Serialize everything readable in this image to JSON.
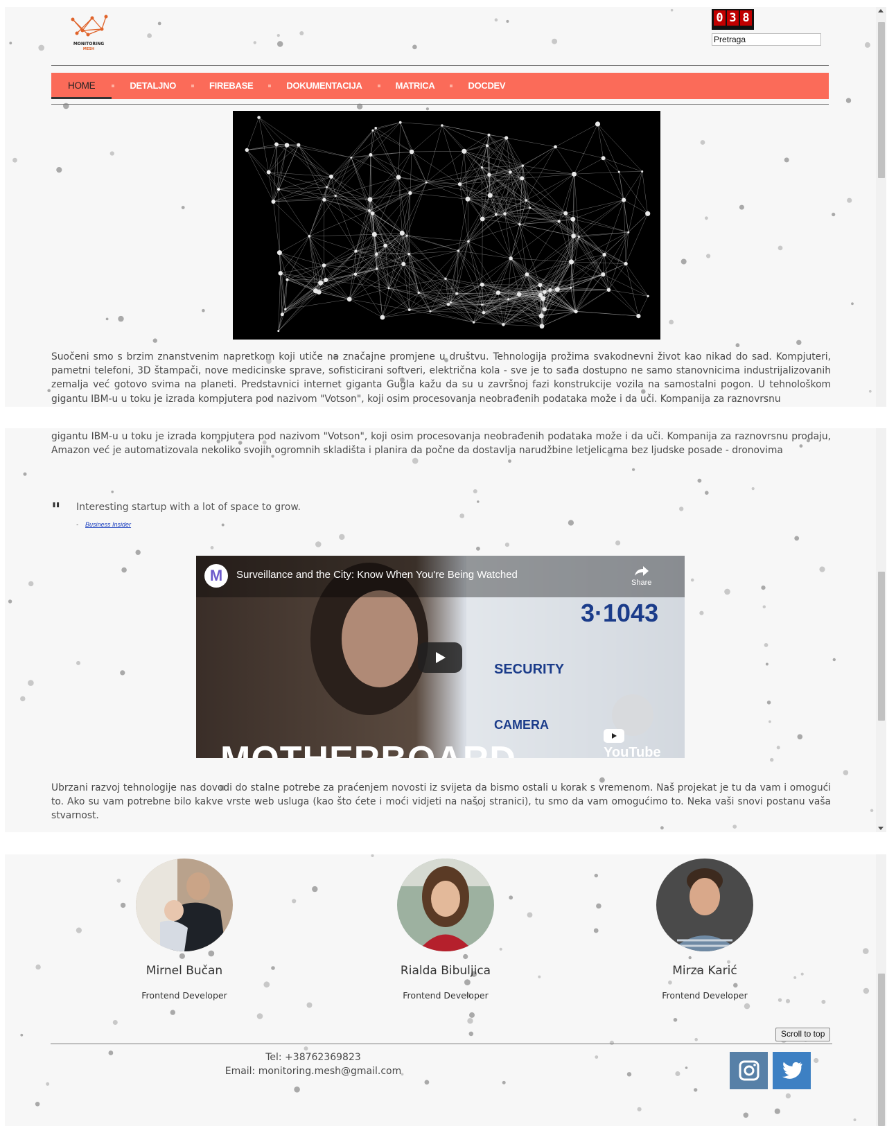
{
  "header": {
    "logo_line1": "MONITORING",
    "logo_line2": "MESH",
    "counter_digits": [
      "0",
      "3",
      "8"
    ],
    "search_value": "Pretraga"
  },
  "nav": {
    "items": [
      {
        "label": "HOME",
        "active": true
      },
      {
        "label": "DETALJNO"
      },
      {
        "label": "FIREBASE"
      },
      {
        "label": "DOKUMENTACIJA"
      },
      {
        "label": "MATRICA"
      },
      {
        "label": "DOCDEV"
      }
    ]
  },
  "intro": {
    "paragraph_part1": "Suočeni smo s brzim znanstvenim napretkom koji utiče na značajne promjene u društvu. Tehnologija prožima svakodnevni život kao nikad do sad. Kompjuteri, pametni telefoni, 3D štampači, nove medicinske sprave, sofisticirani softveri, električna kola - sve je to sada dostupno ne samo stanovnicima industrijalizovanih zemalja već gotovo svima na planeti. Predstavnici internet giganta Gugla kažu da su u završnoj fazi konstrukcije vozila na samostalni pogon. U tehnološkom gigantu IBM-u u toku je izrada kompjutera pod nazivom \"Votson\", koji osim procesovanja neobrađenih podataka može i da uči. Kompanija za raznovrsnu",
    "paragraph_part2": "gigantu IBM-u u toku je izrada kompjutera pod nazivom \"Votson\", koji osim procesovanja neobrađenih podataka može i da uči. Kompanija za raznovrsnu prodaju, Amazon već je automatizovala nekoliko svojih ogromnih skladišta i planira da počne da dostavlja narudžbine letjelicama bez ljudske posade - dronovima"
  },
  "quote": {
    "mark": "\"",
    "text": "Interesting startup with a lot of space to grow.",
    "dash": "-",
    "source": "Business Insider"
  },
  "video": {
    "title": "Surveillance and the City: Know When You're Being Watched",
    "share_label": "Share",
    "platform": "YouTube",
    "watermark": "MOTHERBOARD",
    "channel_initial": "M"
  },
  "outro": {
    "paragraph": "Ubrzani razvoj tehnologije nas dovodi do stalne potrebe za praćenjem novosti iz svijeta da bismo ostali u korak s vremenom. Naš projekat je tu da vam i omogući to. Ako su vam potrebne bilo kakve vrste web usluga (kao što ćete i moći vidjeti na našoj stranici), tu smo da vam omogućimo to. Neka vaši snovi postanu vaša stvarnost."
  },
  "team": [
    {
      "name": "Mirnel Bučan",
      "role": "Frontend Developer"
    },
    {
      "name": "Rialda Bibuljica",
      "role": "Frontend Developer"
    },
    {
      "name": "Mirza Karić",
      "role": "Frontend Developer"
    }
  ],
  "footer": {
    "scroll_top_label": "Scroll to top",
    "tel": "Tel: +38762369823",
    "email": "Email: monitoring.mesh@gmail.com"
  },
  "colors": {
    "nav_bg": "#fb6b59",
    "instagram_bg": "#5780a7",
    "twitter_bg": "#3d80c3",
    "counter_digit_bg": "#c10000"
  },
  "icons": {
    "logo": "network-logo-icon",
    "instagram": "instagram-icon",
    "twitter": "twitter-icon",
    "play": "play-icon",
    "share": "share-arrow-icon",
    "quote": "quote-icon"
  }
}
